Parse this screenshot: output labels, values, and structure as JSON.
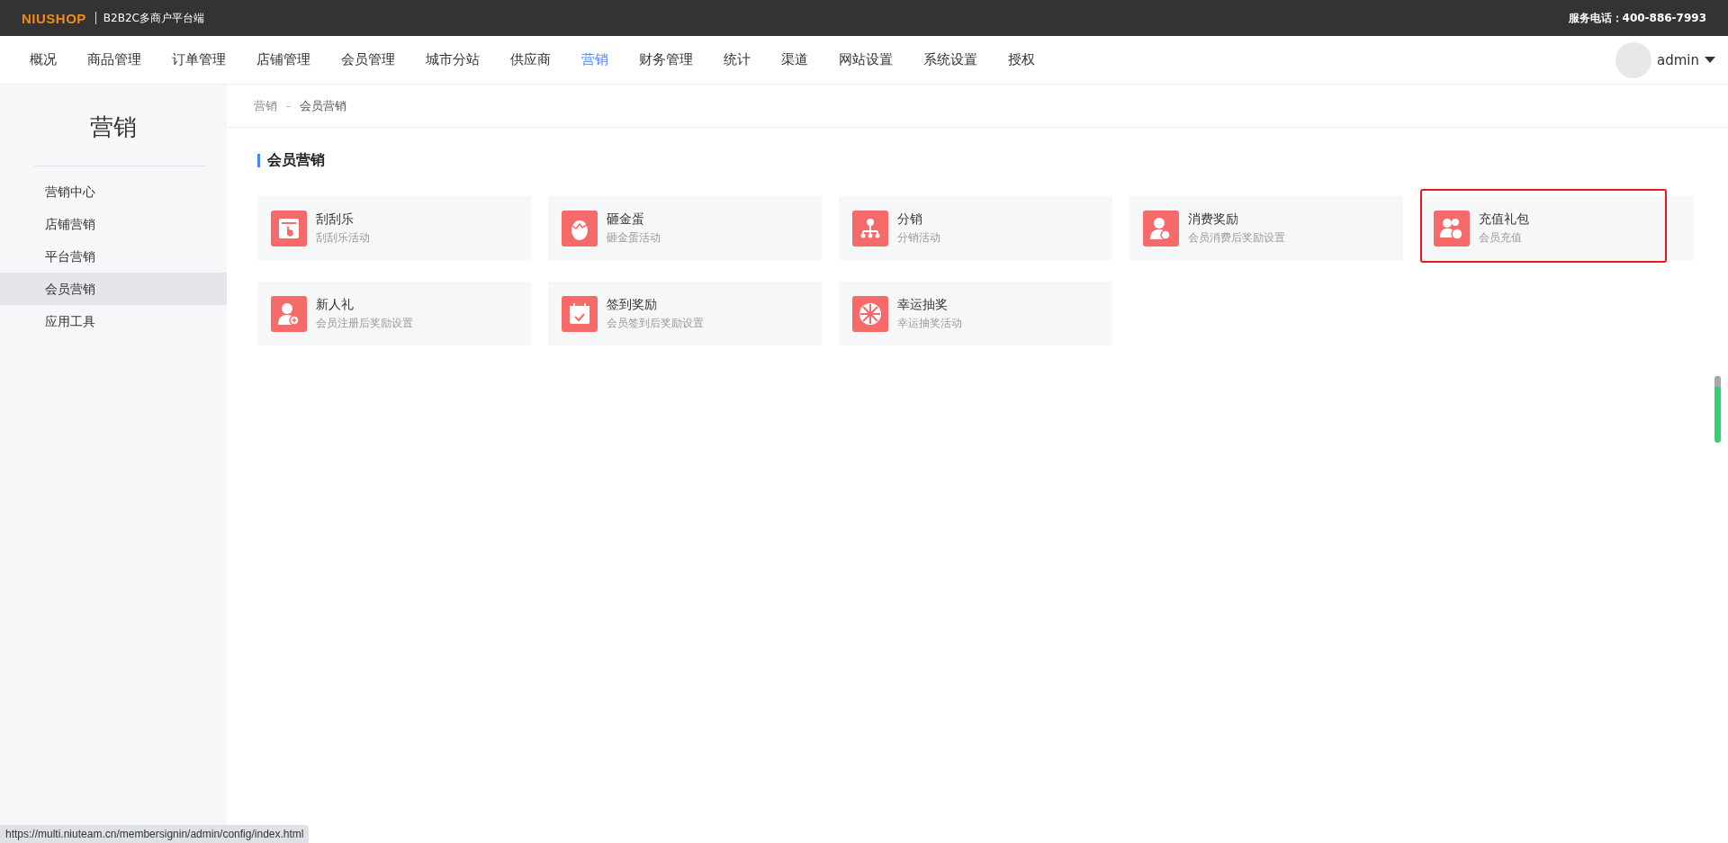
{
  "top_bar": {
    "logo": "NIUSHOP",
    "subtitle": "B2B2C多商户平台端",
    "service_phone": "服务电话：400-886-7993"
  },
  "nav": {
    "items": [
      {
        "label": "概况",
        "selected": false
      },
      {
        "label": "商品管理",
        "selected": false
      },
      {
        "label": "订单管理",
        "selected": false
      },
      {
        "label": "店铺管理",
        "selected": false
      },
      {
        "label": "会员管理",
        "selected": false
      },
      {
        "label": "城市分站",
        "selected": false
      },
      {
        "label": "供应商",
        "selected": false
      },
      {
        "label": "营销",
        "selected": true
      },
      {
        "label": "财务管理",
        "selected": false
      },
      {
        "label": "统计",
        "selected": false
      },
      {
        "label": "渠道",
        "selected": false
      },
      {
        "label": "网站设置",
        "selected": false
      },
      {
        "label": "系统设置",
        "selected": false
      },
      {
        "label": "授权",
        "selected": false
      }
    ],
    "user": "admin"
  },
  "sidebar": {
    "title": "营销",
    "items": [
      {
        "label": "营销中心",
        "selected": false
      },
      {
        "label": "店铺营销",
        "selected": false
      },
      {
        "label": "平台营销",
        "selected": false
      },
      {
        "label": "会员营销",
        "selected": true
      },
      {
        "label": "应用工具",
        "selected": false
      }
    ]
  },
  "breadcrumb": [
    "营销",
    "-",
    "会员营销"
  ],
  "section_title": "会员营销",
  "cards": [
    {
      "title": "刮刮乐",
      "desc": "刮刮乐活动",
      "highlighted": false
    },
    {
      "title": "砸金蛋",
      "desc": "砸金蛋活动",
      "highlighted": false
    },
    {
      "title": "分销",
      "desc": "分销活动",
      "highlighted": false
    },
    {
      "title": "消费奖励",
      "desc": "会员消费后奖励设置",
      "highlighted": false
    },
    {
      "title": "充值礼包",
      "desc": "会员充值",
      "highlighted": true
    },
    {
      "title": "新人礼",
      "desc": "会员注册后奖励设置",
      "highlighted": false
    },
    {
      "title": "签到奖励",
      "desc": "会员签到后奖励设置",
      "highlighted": false
    },
    {
      "title": "幸运抽奖",
      "desc": "幸运抽奖活动",
      "highlighted": false
    }
  ],
  "status_url": "https://multi.niuteam.cn/membersignin/admin/config/index.html"
}
